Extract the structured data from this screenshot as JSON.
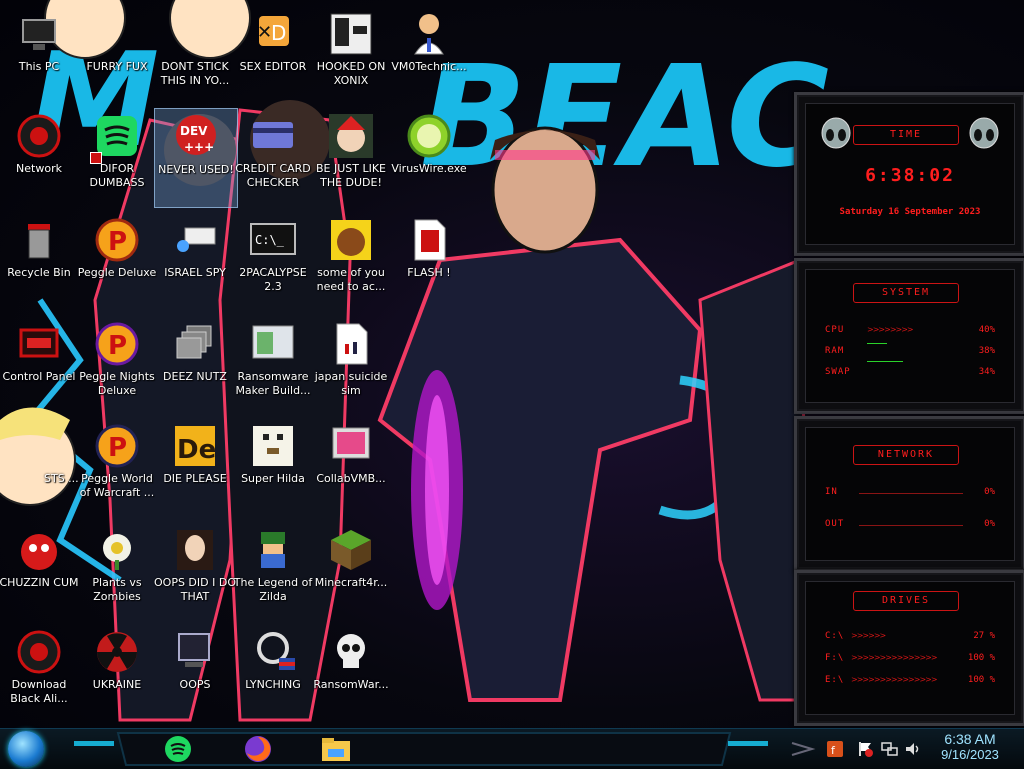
{
  "desktop_icons": [
    {
      "label": "This PC"
    },
    {
      "label": "FURRY FUX"
    },
    {
      "label": "DONT STICK THIS IN YO..."
    },
    {
      "label": "SEX EDITOR"
    },
    {
      "label": "HOOKED ON XONIX"
    },
    {
      "label": "VM0Technic..."
    },
    {
      "label": "Network"
    },
    {
      "label": "DIFOR DUMBASS"
    },
    {
      "label": "NEVER USED!"
    },
    {
      "label": "CREDIT CARD CHECKER"
    },
    {
      "label": "BE JUST LIKE THE DUDE!"
    },
    {
      "label": "VirusWire.exe"
    },
    {
      "label": "Recycle Bin"
    },
    {
      "label": "Peggle Deluxe"
    },
    {
      "label": "ISRAEL SPY"
    },
    {
      "label": "2PACALYPSE 2.3"
    },
    {
      "label": "some of you need to ac..."
    },
    {
      "label": "FLASH !"
    },
    {
      "label": "Control Panel"
    },
    {
      "label": "Peggle Nights Deluxe"
    },
    {
      "label": "DEEZ NUTZ"
    },
    {
      "label": "Ransomware Maker Build..."
    },
    {
      "label": "japan suicide sim"
    },
    {
      "label": "STS ..."
    },
    {
      "label": "Peggle World of Warcraft ..."
    },
    {
      "label": "DIE PLEASE"
    },
    {
      "label": "Super Hilda"
    },
    {
      "label": "CollabVMB..."
    },
    {
      "label": "CHUZZIN CUM"
    },
    {
      "label": "Plants vs Zombies"
    },
    {
      "label": "OOPS DID I DO THAT"
    },
    {
      "label": "The Legend of Zilda"
    },
    {
      "label": "Minecraft4r..."
    },
    {
      "label": "Download Black Ali..."
    },
    {
      "label": "UKRAINE"
    },
    {
      "label": "OOPS"
    },
    {
      "label": "LYNCHING"
    },
    {
      "label": "RansomWar..."
    }
  ],
  "wallpaper": {
    "banner_text": "BEAC"
  },
  "widget": {
    "time_panel": {
      "title": "TIME",
      "clock": "6:38:02",
      "date": "Saturday 16 September 2023"
    },
    "system_panel": {
      "title": "SYSTEM",
      "rows": [
        {
          "label": "CPU",
          "arrows": ">>>>>>>>",
          "value": "40%",
          "level": 0.4
        },
        {
          "label": "RAM",
          "arrows": "",
          "value": "38%",
          "level": 0.38
        },
        {
          "label": "SWAP",
          "arrows": "",
          "value": "34%",
          "level": 0.34
        }
      ]
    },
    "network_panel": {
      "title": "NETWORK",
      "rows": [
        {
          "label": "IN",
          "value": "0%"
        },
        {
          "label": "OUT",
          "value": "0%"
        }
      ]
    },
    "drives_panel": {
      "title": "DRIVES",
      "rows": [
        {
          "label": "C:\\",
          "arrows": ">>>>>>",
          "value": "27 %"
        },
        {
          "label": "F:\\",
          "arrows": ">>>>>>>>>>>>>>>",
          "value": "100 %"
        },
        {
          "label": "E:\\",
          "arrows": ">>>>>>>>>>>>>>>",
          "value": "100 %"
        }
      ]
    }
  },
  "taskbar": {
    "clock_time": "6:38 AM",
    "clock_date": "9/16/2023",
    "pinned": [
      {
        "icon": "spotify-icon"
      },
      {
        "icon": "firefox-icon"
      },
      {
        "icon": "file-explorer-icon"
      }
    ],
    "tray": [
      {
        "icon": "flash-player-tray-icon"
      },
      {
        "icon": "alert-flag-icon"
      },
      {
        "icon": "network-tray-icon"
      },
      {
        "icon": "volume-icon"
      }
    ]
  },
  "colors": {
    "widget_accent": "#ff1e1e",
    "clock_text": "#ffffff",
    "taskbar_glow": "#1ad3ff"
  }
}
